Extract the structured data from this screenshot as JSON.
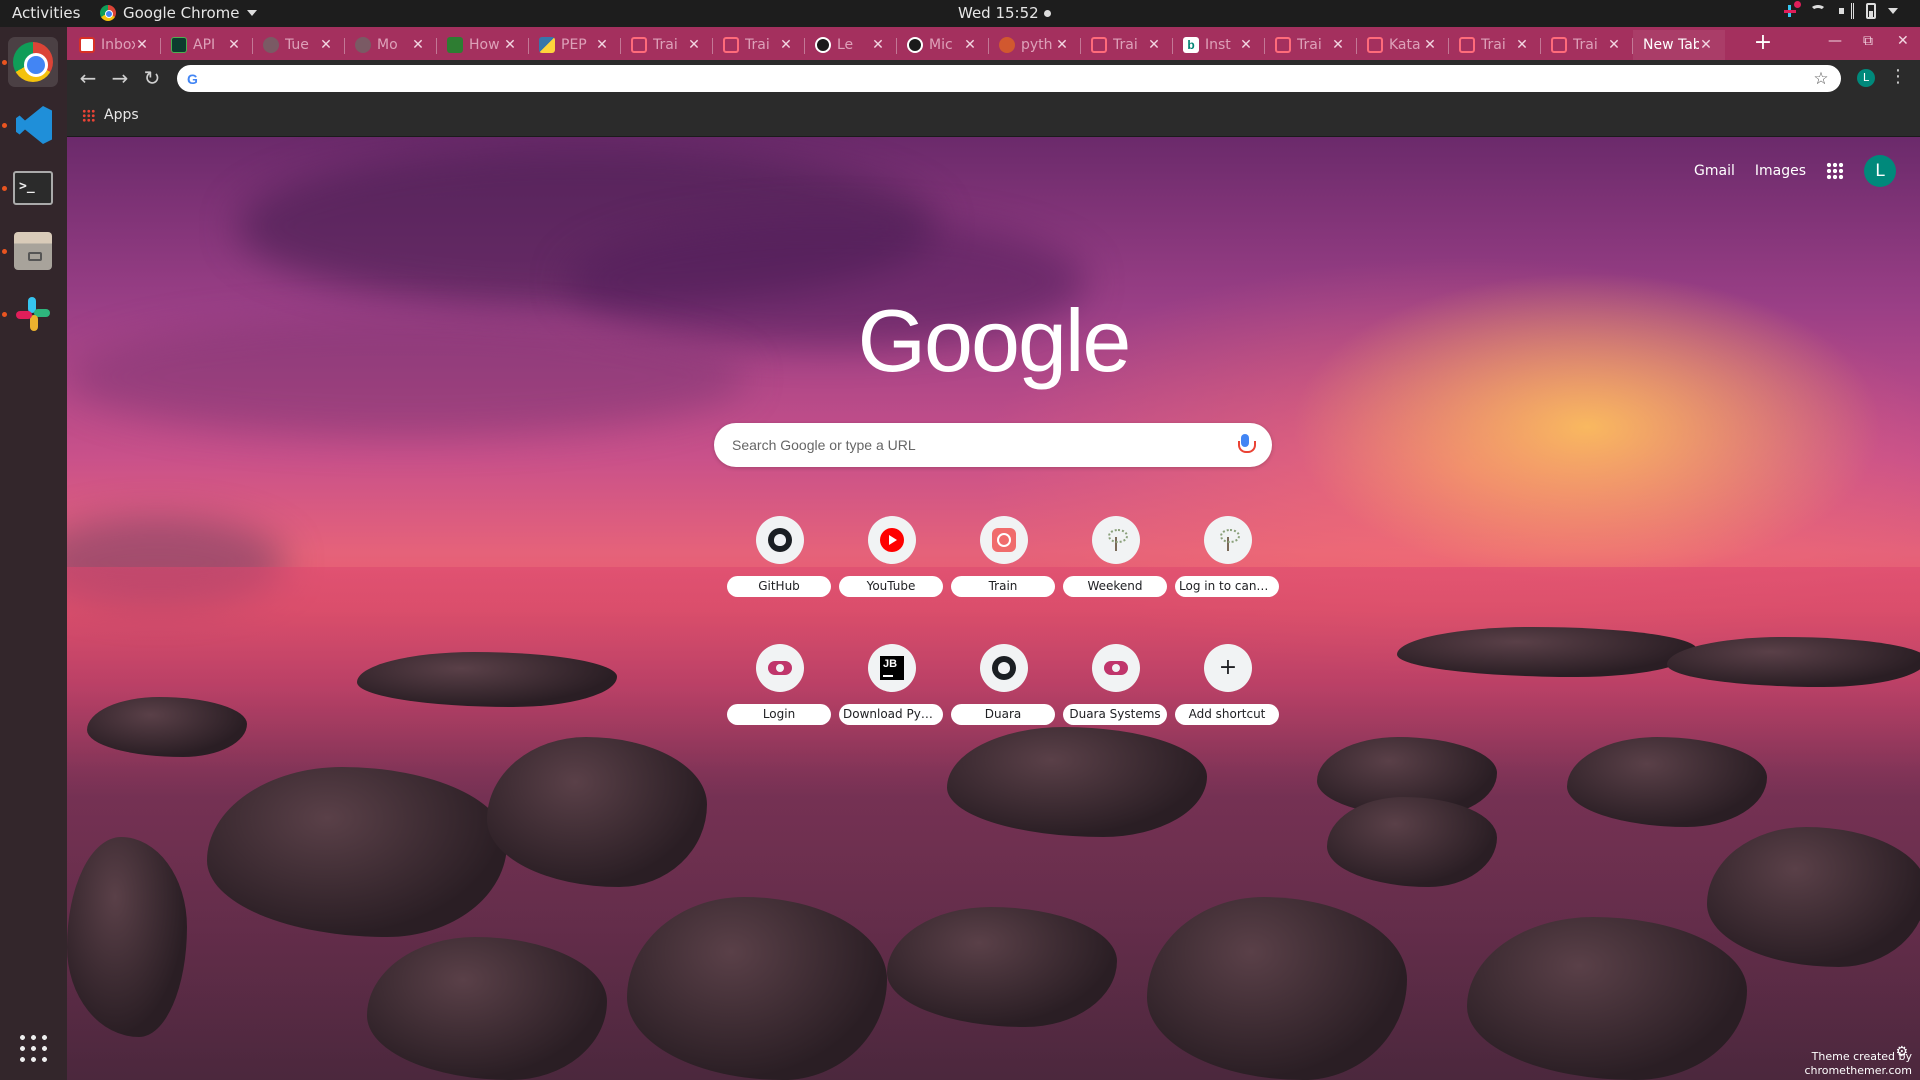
{
  "topbar": {
    "activities": "Activities",
    "app_name": "Google Chrome",
    "clock": "Wed 15:52"
  },
  "dock": {
    "items": [
      "chrome",
      "vscode",
      "terminal",
      "files",
      "slack"
    ],
    "terminal_glyph": ">_"
  },
  "tabs": [
    {
      "title": "Inbox",
      "favicon": "gmail-icon",
      "active": false
    },
    {
      "title": "API",
      "favicon": "dark-doc-icon",
      "active": false
    },
    {
      "title": "Tue",
      "favicon": "tree-icon",
      "active": false
    },
    {
      "title": "Mo",
      "favicon": "tree-icon",
      "active": false
    },
    {
      "title": "How",
      "favicon": "green-doc-icon",
      "active": false
    },
    {
      "title": "PEP",
      "favicon": "python-icon",
      "active": false
    },
    {
      "title": "Trai",
      "favicon": "train-icon",
      "active": false
    },
    {
      "title": "Trai",
      "favicon": "train-icon",
      "active": false
    },
    {
      "title": "Le",
      "favicon": "github-icon",
      "active": false
    },
    {
      "title": "Mic",
      "favicon": "github-icon",
      "active": false
    },
    {
      "title": "pyth",
      "favicon": "orange-icon",
      "active": false
    },
    {
      "title": "Trai",
      "favicon": "train-icon",
      "active": false
    },
    {
      "title": "Inst",
      "favicon": "bing-icon",
      "active": false
    },
    {
      "title": "Trai",
      "favicon": "train-icon",
      "active": false
    },
    {
      "title": "Kata",
      "favicon": "train-icon",
      "active": false
    },
    {
      "title": "Trai",
      "favicon": "train-icon",
      "active": false
    },
    {
      "title": "Trai",
      "favicon": "train-icon",
      "active": false
    },
    {
      "title": "New Tab",
      "favicon": "",
      "active": true
    }
  ],
  "newtab_label": "+",
  "omnibox": {
    "value": "",
    "g_glyph": "G"
  },
  "toolbar": {
    "avatar_letter": "L"
  },
  "bookmarks": {
    "apps_label": "Apps"
  },
  "ntp": {
    "gmail_link": "Gmail",
    "images_link": "Images",
    "avatar_letter": "L",
    "logo_text": "Google",
    "search_placeholder": "Search Google or type a URL",
    "shortcuts": [
      {
        "label": "GitHub",
        "icon": "github-icon"
      },
      {
        "label": "YouTube",
        "icon": "youtube-icon"
      },
      {
        "label": "Train",
        "icon": "train-icon"
      },
      {
        "label": "Weekend",
        "icon": "tree-icon"
      },
      {
        "label": "Log in to canvas",
        "icon": "tree-icon"
      },
      {
        "label": "Login",
        "icon": "cloud-icon"
      },
      {
        "label": "Download PyC...",
        "icon": "jetbrains-icon"
      },
      {
        "label": "Duara",
        "icon": "github-icon"
      },
      {
        "label": "Duara Systems",
        "icon": "cloud-icon"
      },
      {
        "label": "Add shortcut",
        "icon": "plus-icon"
      }
    ],
    "theme_credit_line1": "Theme created by",
    "theme_credit_line2": "chromethemer.com"
  },
  "colors": {
    "tabstrip": "#a4305e",
    "dock": "#33262b",
    "avatar": "#00897b"
  }
}
